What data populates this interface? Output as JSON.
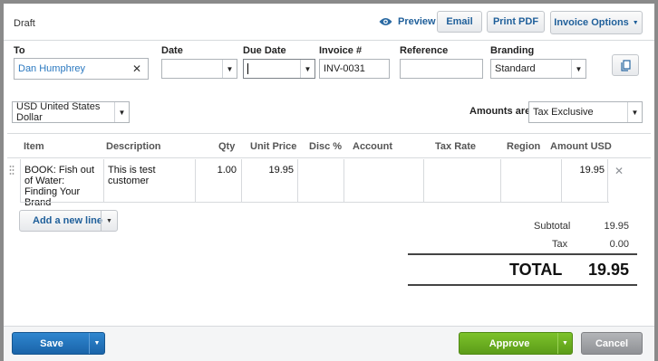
{
  "header": {
    "status": "Draft",
    "preview_label": "Preview",
    "email_label": "Email",
    "print_pdf_label": "Print PDF",
    "invoice_options_label": "Invoice Options"
  },
  "form": {
    "to_label": "To",
    "to_value": "Dan Humphrey",
    "date_label": "Date",
    "date_value": "",
    "due_date_label": "Due Date",
    "due_date_value": "",
    "invoice_no_label": "Invoice #",
    "invoice_no_value": "INV-0031",
    "reference_label": "Reference",
    "reference_value": "",
    "branding_label": "Branding",
    "branding_value": "Standard"
  },
  "currency": {
    "value": "USD United States Dollar",
    "amounts_are_label": "Amounts are",
    "amounts_are_value": "Tax Exclusive"
  },
  "table": {
    "headers": {
      "item": "Item",
      "description": "Description",
      "qty": "Qty",
      "unit_price": "Unit Price",
      "disc": "Disc %",
      "account": "Account",
      "tax_rate": "Tax Rate",
      "region": "Region",
      "amount": "Amount USD"
    },
    "rows": [
      {
        "item": "BOOK: Fish out of Water: Finding Your Brand",
        "description": "This is test customer",
        "qty": "1.00",
        "unit_price": "19.95",
        "disc": "",
        "account": "",
        "tax_rate": "",
        "region": "",
        "amount": "19.95"
      }
    ]
  },
  "add_line_label": "Add a new line",
  "totals": {
    "subtotal_label": "Subtotal",
    "subtotal_value": "19.95",
    "tax_label": "Tax",
    "tax_value": "0.00",
    "total_label": "TOTAL",
    "total_value": "19.95"
  },
  "footer": {
    "save_label": "Save",
    "approve_label": "Approve",
    "cancel_label": "Cancel"
  },
  "colors": {
    "primary_blue": "#1f6fb4",
    "approve_green": "#69ad1f",
    "cancel_gray": "#9a9c9f",
    "link_blue": "#1f5f9a"
  },
  "icons": {
    "preview": "eye-icon",
    "copy": "copy-icon",
    "clear": "close-icon",
    "drag": "drag-handle-icon"
  }
}
